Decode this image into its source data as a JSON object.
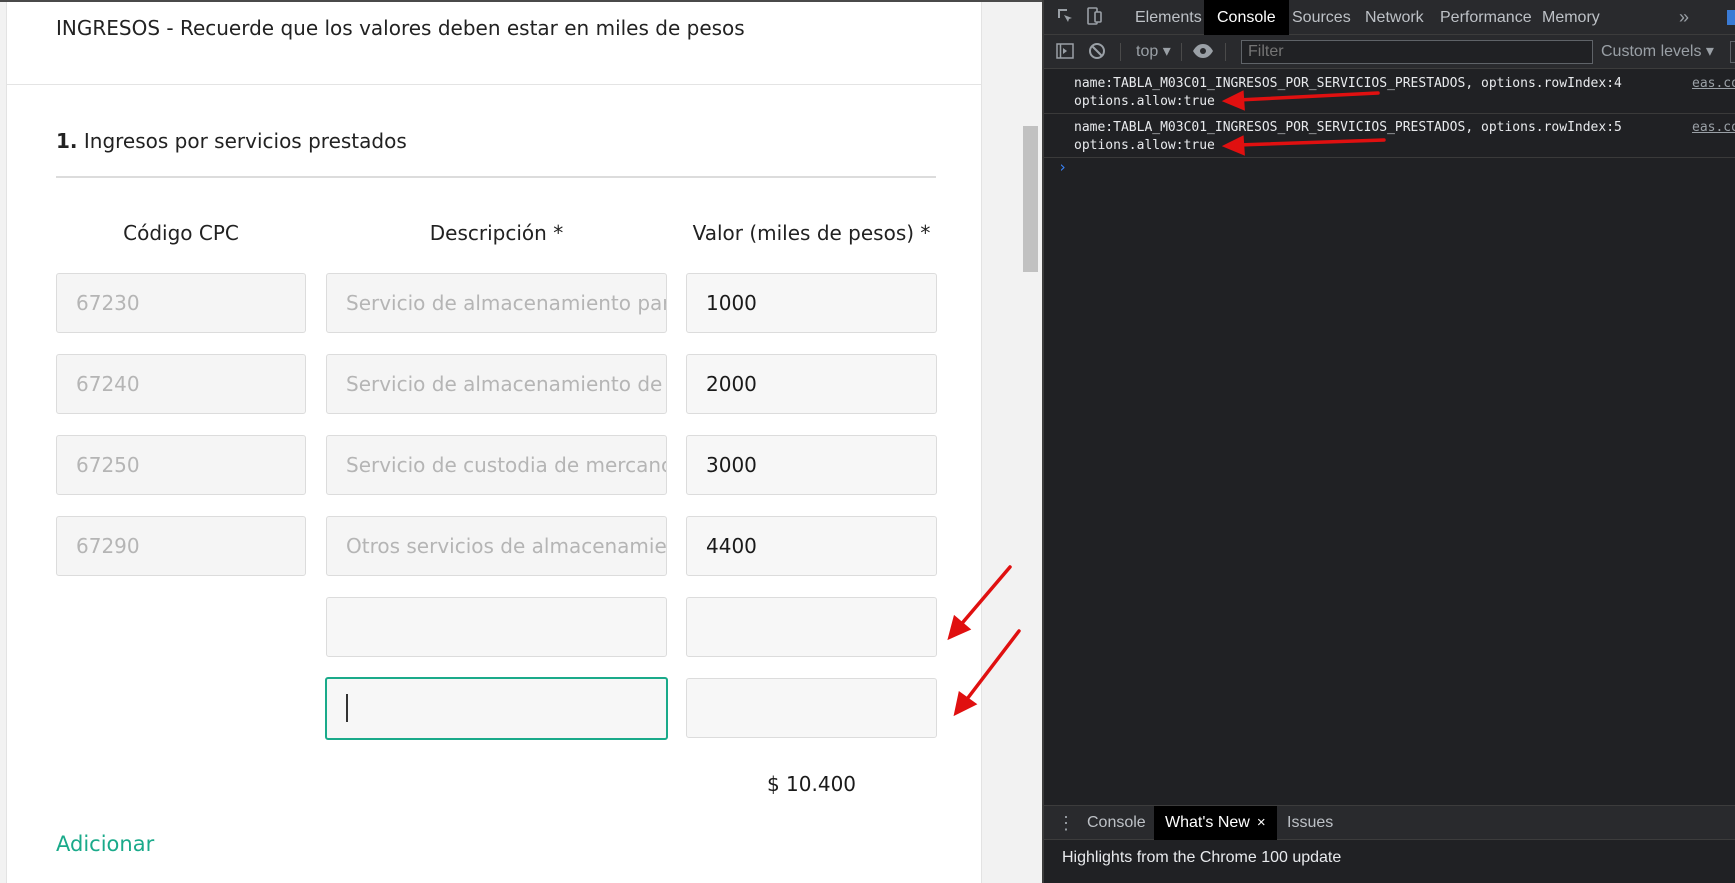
{
  "form": {
    "section_header": "INGRESOS - Recuerde que los valores deben estar en miles de pesos",
    "subsection_number": "1.",
    "subsection_title": "Ingresos por servicios prestados",
    "columns": {
      "cpc": "Código CPC",
      "description": "Descripción *",
      "value": "Valor (miles de pesos) *"
    },
    "rows": [
      {
        "cpc": "67230",
        "description": "Servicio de almacenamiento para",
        "value": "1000"
      },
      {
        "cpc": "67240",
        "description": "Servicio de almacenamiento de grano",
        "value": "2000"
      },
      {
        "cpc": "67250",
        "description": "Servicio de custodia de mercancías",
        "value": "3000"
      },
      {
        "cpc": "67290",
        "description": "Otros servicios de almacenamiento",
        "value": "4400"
      },
      {
        "cpc": "",
        "description": "",
        "value": ""
      },
      {
        "cpc": "",
        "description": "",
        "value": ""
      }
    ],
    "total": "$ 10.400",
    "add_link": "Adicionar",
    "accent_color": "#1aaa8a",
    "annotation_color": "#e01010"
  },
  "devtools": {
    "tabs": [
      "Elements",
      "Console",
      "Sources",
      "Network",
      "Performance",
      "Memory"
    ],
    "active_tab": "Console",
    "more_tabs": "»",
    "context": "top ▾",
    "filter_placeholder": "Filter",
    "levels": "Custom levels ▾",
    "logs": [
      {
        "line1": "name:TABLA_M03C01_INGRESOS_POR_SERVICIOS_PRESTADOS, options.rowIndex:4",
        "line2": "options.allow:true",
        "source": "eas.co"
      },
      {
        "line1": "name:TABLA_M03C01_INGRESOS_POR_SERVICIOS_PRESTADOS, options.rowIndex:5",
        "line2": "options.allow:true",
        "source": "eas.co"
      }
    ],
    "prompt": "›",
    "drawer_tabs": [
      "Console",
      "What's New",
      "Issues"
    ],
    "drawer_active": "What's New",
    "drawer_close": "×",
    "drawer_content": "Highlights from the Chrome 100 update"
  }
}
